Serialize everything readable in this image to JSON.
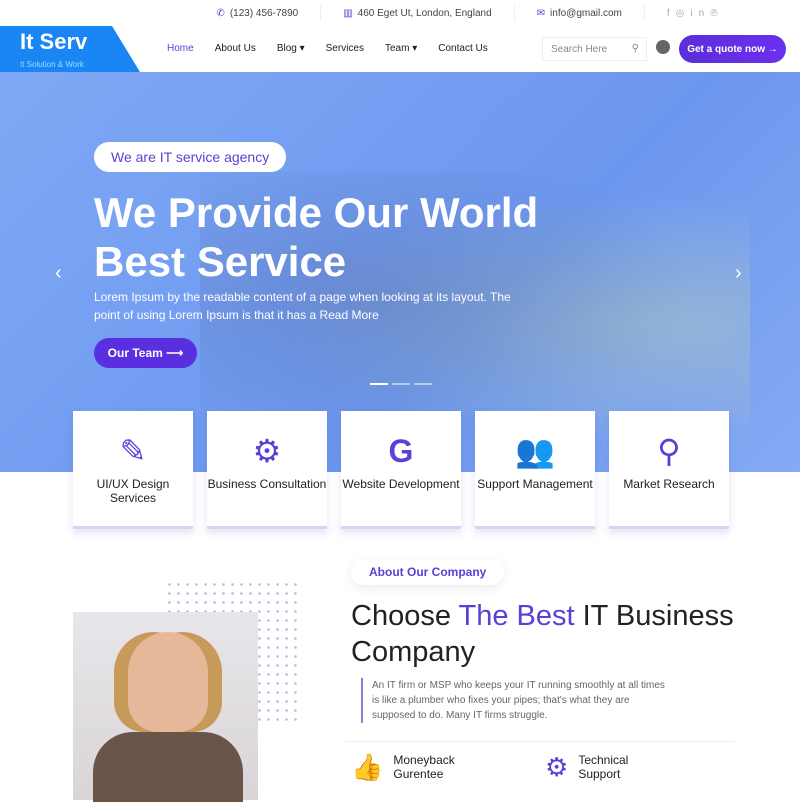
{
  "topbar": {
    "phone": "(123) 456-7890",
    "address": "460 Eget Ut, London, England",
    "email": "info@gmail.com",
    "social": [
      "facebook-icon",
      "instagram-icon",
      "linkedin-icon",
      "pinterest-icon"
    ]
  },
  "brand": {
    "name": "It Serv",
    "tagline": "It Solution & Work"
  },
  "nav": {
    "items": [
      {
        "label": "Home"
      },
      {
        "label": "About Us"
      },
      {
        "label": "Blog ▾"
      },
      {
        "label": "Services"
      },
      {
        "label": "Team ▾"
      },
      {
        "label": "Contact Us"
      }
    ],
    "search_placeholder": "Search Here",
    "cta": "Get a quote now →"
  },
  "hero": {
    "tag": "We are IT service agency",
    "title": "We Provide Our World Best Service",
    "text": "Lorem Ipsum by the readable content of a page when looking at its layout. The point of using Lorem Ipsum is that it has a Read More",
    "button": "Our Team ⟶",
    "prev": "‹",
    "next": "›"
  },
  "services": [
    {
      "icon": "edit-icon",
      "glyph": "✎",
      "label": "UI/UX Design Services"
    },
    {
      "icon": "gear-icon",
      "glyph": "⚙",
      "label": "Business Consultation"
    },
    {
      "icon": "google-icon",
      "glyph": "G",
      "label": "Website Development"
    },
    {
      "icon": "users-icon",
      "glyph": "👥",
      "label": "Support Management"
    },
    {
      "icon": "search-icon",
      "glyph": "⚲",
      "label": "Market Research"
    }
  ],
  "about": {
    "tag": "About Our Company",
    "title_a": "Choose ",
    "title_hl": "The Best",
    "title_b": " IT Business Company",
    "text": "An IT firm or MSP who keeps your IT running smoothly at all times is like a plumber who fixes your pipes; that's what they are supposed to do. Many IT firms struggle.",
    "features": [
      {
        "icon": "thumbs-up-icon",
        "glyph": "👍",
        "label": "Moneyback Gurentee"
      },
      {
        "icon": "gear-icon",
        "glyph": "⚙",
        "label": "Technical Support"
      }
    ]
  },
  "colors": {
    "accent": "#5a3fd8",
    "brand": "#1a86f6",
    "hero": "#7fa8f5"
  }
}
